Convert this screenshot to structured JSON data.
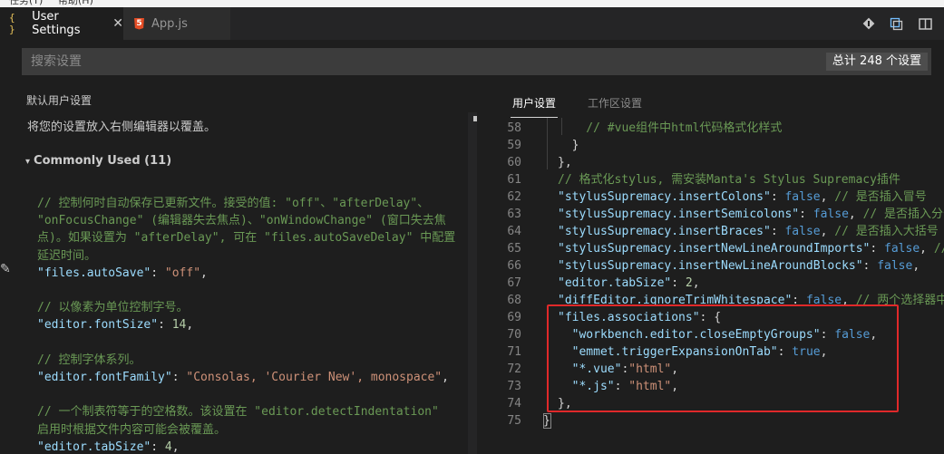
{
  "menubar": {
    "items": [
      "任务(T)",
      "帮助(H)"
    ]
  },
  "tabs": [
    {
      "label": "User Settings",
      "icon": "{ }",
      "active": true
    },
    {
      "label": "App.js",
      "icon": "html5-icon",
      "active": false
    }
  ],
  "toolbar": {
    "icons": [
      "go-to-file-icon",
      "open-changes-icon",
      "split-editor-icon"
    ]
  },
  "search": {
    "placeholder": "搜索设置",
    "count": "总计 248 个设置"
  },
  "left": {
    "header": "默认用户设置",
    "hint": "将您的设置放入右侧编辑器以覆盖。",
    "section": "Commonly Used (11)",
    "lines": [
      {
        "cls": "cm",
        "text": "// 控制何时自动保存已更新文件。接受的值: \"off\"、\"afterDelay\"、"
      },
      {
        "cls": "cm",
        "text": "\"onFocusChange\" (编辑器失去焦点)、\"onWindowChange\" (窗口失去焦"
      },
      {
        "cls": "cm",
        "text": "点)。如果设置为 \"afterDelay\", 可在 \"files.autoSaveDelay\" 中配置"
      },
      {
        "cls": "cm",
        "text": "延迟时间。"
      },
      {
        "key": "\"files.autoSave\"",
        "sep": ": ",
        "val": "\"off\"",
        "vcls": "str",
        "end": ","
      },
      {
        "cls": "cm",
        "text": ""
      },
      {
        "cls": "cm",
        "text": "// 以像素为单位控制字号。"
      },
      {
        "key": "\"editor.fontSize\"",
        "sep": ": ",
        "val": "14",
        "vcls": "num",
        "end": ","
      },
      {
        "cls": "cm",
        "text": ""
      },
      {
        "cls": "cm",
        "text": "// 控制字体系列。"
      },
      {
        "key": "\"editor.fontFamily\"",
        "sep": ": ",
        "val": "\"Consolas, 'Courier New', monospace\"",
        "vcls": "str",
        "end": ","
      },
      {
        "cls": "cm",
        "text": ""
      },
      {
        "cls": "cm",
        "text": "// 一个制表符等于的空格数。该设置在 \"editor.detectIndentation\""
      },
      {
        "cls": "cm",
        "text": "启用时根据文件内容可能会被覆盖。"
      },
      {
        "key": "\"editor.tabSize\"",
        "sep": ": ",
        "val": "4",
        "vcls": "num",
        "end": ","
      }
    ]
  },
  "right": {
    "tabs": [
      "用户设置",
      "工作区设置"
    ],
    "line_numbers": [
      "58",
      "59",
      "60",
      "61",
      "62",
      "63",
      "64",
      "65",
      "66",
      "67",
      "68",
      "69",
      "70",
      "71",
      "72",
      "73",
      "74",
      "75"
    ],
    "lines": [
      [
        {
          "c": "cm",
          "t": "    // #vue组件中html代码格式化样式"
        }
      ],
      [
        {
          "c": "punc",
          "t": "  }"
        }
      ],
      [
        {
          "c": "punc",
          "t": "},"
        }
      ],
      [
        {
          "c": "cm",
          "t": "// 格式化stylus, 需安装Manta's Stylus Supremacy插件"
        }
      ],
      [
        {
          "c": "key",
          "t": "\"stylusSupremacy.insertColons\""
        },
        {
          "c": "punc",
          "t": ": "
        },
        {
          "c": "kw",
          "t": "false"
        },
        {
          "c": "punc",
          "t": ", "
        },
        {
          "c": "cm",
          "t": "// 是否插入冒号"
        }
      ],
      [
        {
          "c": "key",
          "t": "\"stylusSupremacy.insertSemicolons\""
        },
        {
          "c": "punc",
          "t": ": "
        },
        {
          "c": "kw",
          "t": "false"
        },
        {
          "c": "punc",
          "t": ", "
        },
        {
          "c": "cm",
          "t": "// 是否插入分号"
        }
      ],
      [
        {
          "c": "key",
          "t": "\"stylusSupremacy.insertBraces\""
        },
        {
          "c": "punc",
          "t": ": "
        },
        {
          "c": "kw",
          "t": "false"
        },
        {
          "c": "punc",
          "t": ", "
        },
        {
          "c": "cm",
          "t": "// 是否插入大括号"
        }
      ],
      [
        {
          "c": "key",
          "t": "\"stylusSupremacy.insertNewLineAroundImports\""
        },
        {
          "c": "punc",
          "t": ": "
        },
        {
          "c": "kw",
          "t": "false"
        },
        {
          "c": "punc",
          "t": ", "
        },
        {
          "c": "cm",
          "t": "// import之后"
        }
      ],
      [
        {
          "c": "key",
          "t": "\"stylusSupremacy.insertNewLineAroundBlocks\""
        },
        {
          "c": "punc",
          "t": ": "
        },
        {
          "c": "kw",
          "t": "false"
        },
        {
          "c": "punc",
          "t": ","
        }
      ],
      [
        {
          "c": "key",
          "t": "\"editor.tabSize\""
        },
        {
          "c": "punc",
          "t": ": "
        },
        {
          "c": "num",
          "t": "2"
        },
        {
          "c": "punc",
          "t": ","
        }
      ],
      [
        {
          "c": "key",
          "t": "\"diffEditor.ignoreTrimWhitespace\""
        },
        {
          "c": "punc",
          "t": ": "
        },
        {
          "c": "kw",
          "t": "false"
        },
        {
          "c": "punc",
          "t": ", "
        },
        {
          "c": "cm",
          "t": "// 两个选择器中"
        }
      ],
      [
        {
          "c": "key",
          "t": "\"files.associations\""
        },
        {
          "c": "punc",
          "t": ": {"
        }
      ],
      [
        {
          "c": "key",
          "t": "  \"workbench.editor.closeEmptyGroups\""
        },
        {
          "c": "punc",
          "t": ": "
        },
        {
          "c": "kw",
          "t": "false"
        },
        {
          "c": "punc",
          "t": ","
        }
      ],
      [
        {
          "c": "key",
          "t": "  \"emmet.triggerExpansionOnTab\""
        },
        {
          "c": "punc",
          "t": ": "
        },
        {
          "c": "kw",
          "t": "true"
        },
        {
          "c": "punc",
          "t": ","
        }
      ],
      [
        {
          "c": "key",
          "t": "  \"*.vue\""
        },
        {
          "c": "punc",
          "t": ":"
        },
        {
          "c": "str",
          "t": "\"html\""
        },
        {
          "c": "punc",
          "t": ","
        }
      ],
      [
        {
          "c": "key",
          "t": "  \"*.js\""
        },
        {
          "c": "punc",
          "t": ": "
        },
        {
          "c": "str",
          "t": "\"html\""
        },
        {
          "c": "punc",
          "t": ","
        }
      ],
      [
        {
          "c": "punc",
          "t": "},"
        }
      ],
      [
        {
          "c": "punc",
          "t": "}"
        }
      ]
    ]
  },
  "colors": {
    "highlight_border": "#e0292a",
    "comment": "#6a9955",
    "key": "#9cdcfe",
    "string": "#ce9178"
  }
}
